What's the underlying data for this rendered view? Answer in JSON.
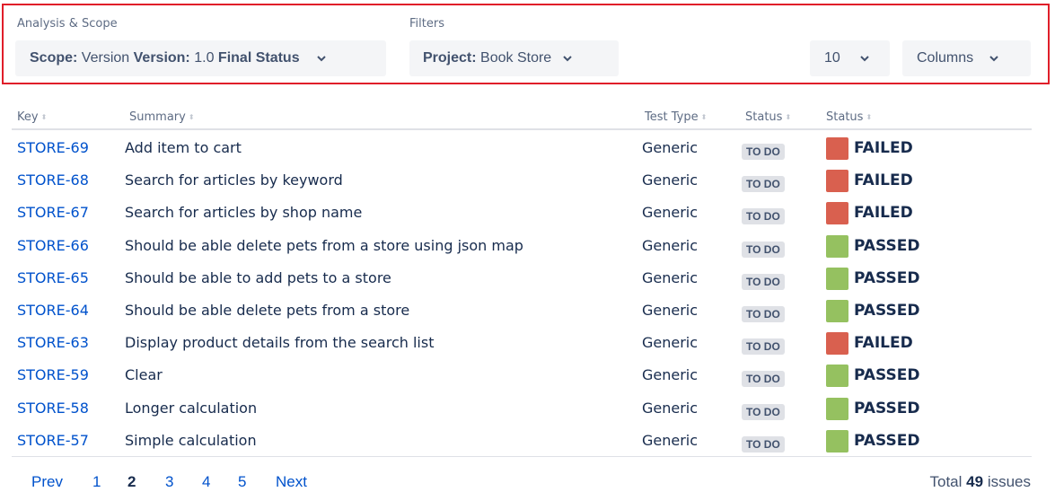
{
  "analysis_scope": {
    "label": "Analysis & Scope",
    "scope_key": "Scope:",
    "scope_value": "Version",
    "version_key": "Version:",
    "version_value": "1.0",
    "final_status_key": "Final Status"
  },
  "filters": {
    "label": "Filters",
    "project_key": "Project:",
    "project_value": "Book Store"
  },
  "page_size": "10",
  "columns_label": "Columns",
  "table": {
    "headers": [
      "Key",
      "Summary",
      "Test Type",
      "Status",
      "Status"
    ],
    "rows": [
      {
        "key": "STORE-69",
        "summary": "Add item to cart",
        "test_type": "Generic",
        "status": "TO DO",
        "result": "FAILED",
        "result_color": "#d9604f"
      },
      {
        "key": "STORE-68",
        "summary": "Search for articles by keyword",
        "test_type": "Generic",
        "status": "TO DO",
        "result": "FAILED",
        "result_color": "#d9604f"
      },
      {
        "key": "STORE-67",
        "summary": "Search for articles by shop name",
        "test_type": "Generic",
        "status": "TO DO",
        "result": "FAILED",
        "result_color": "#d9604f"
      },
      {
        "key": "STORE-66",
        "summary": "Should be able delete pets from a store using json map",
        "test_type": "Generic",
        "status": "TO DO",
        "result": "PASSED",
        "result_color": "#95c160"
      },
      {
        "key": "STORE-65",
        "summary": "Should be able to add pets to a store",
        "test_type": "Generic",
        "status": "TO DO",
        "result": "PASSED",
        "result_color": "#95c160"
      },
      {
        "key": "STORE-64",
        "summary": "Should be able delete pets from a store",
        "test_type": "Generic",
        "status": "TO DO",
        "result": "PASSED",
        "result_color": "#95c160"
      },
      {
        "key": "STORE-63",
        "summary": "Display product details from the search list",
        "test_type": "Generic",
        "status": "TO DO",
        "result": "FAILED",
        "result_color": "#d9604f"
      },
      {
        "key": "STORE-59",
        "summary": "Clear",
        "test_type": "Generic",
        "status": "TO DO",
        "result": "PASSED",
        "result_color": "#95c160"
      },
      {
        "key": "STORE-58",
        "summary": "Longer calculation",
        "test_type": "Generic",
        "status": "TO DO",
        "result": "PASSED",
        "result_color": "#95c160"
      },
      {
        "key": "STORE-57",
        "summary": "Simple calculation",
        "test_type": "Generic",
        "status": "TO DO",
        "result": "PASSED",
        "result_color": "#95c160"
      }
    ]
  },
  "pagination": {
    "prev": "Prev",
    "pages": [
      "1",
      "2",
      "3",
      "4",
      "5"
    ],
    "current_page": "2",
    "next": "Next"
  },
  "total": {
    "prefix": "Total",
    "count": "49",
    "suffix": "issues"
  }
}
